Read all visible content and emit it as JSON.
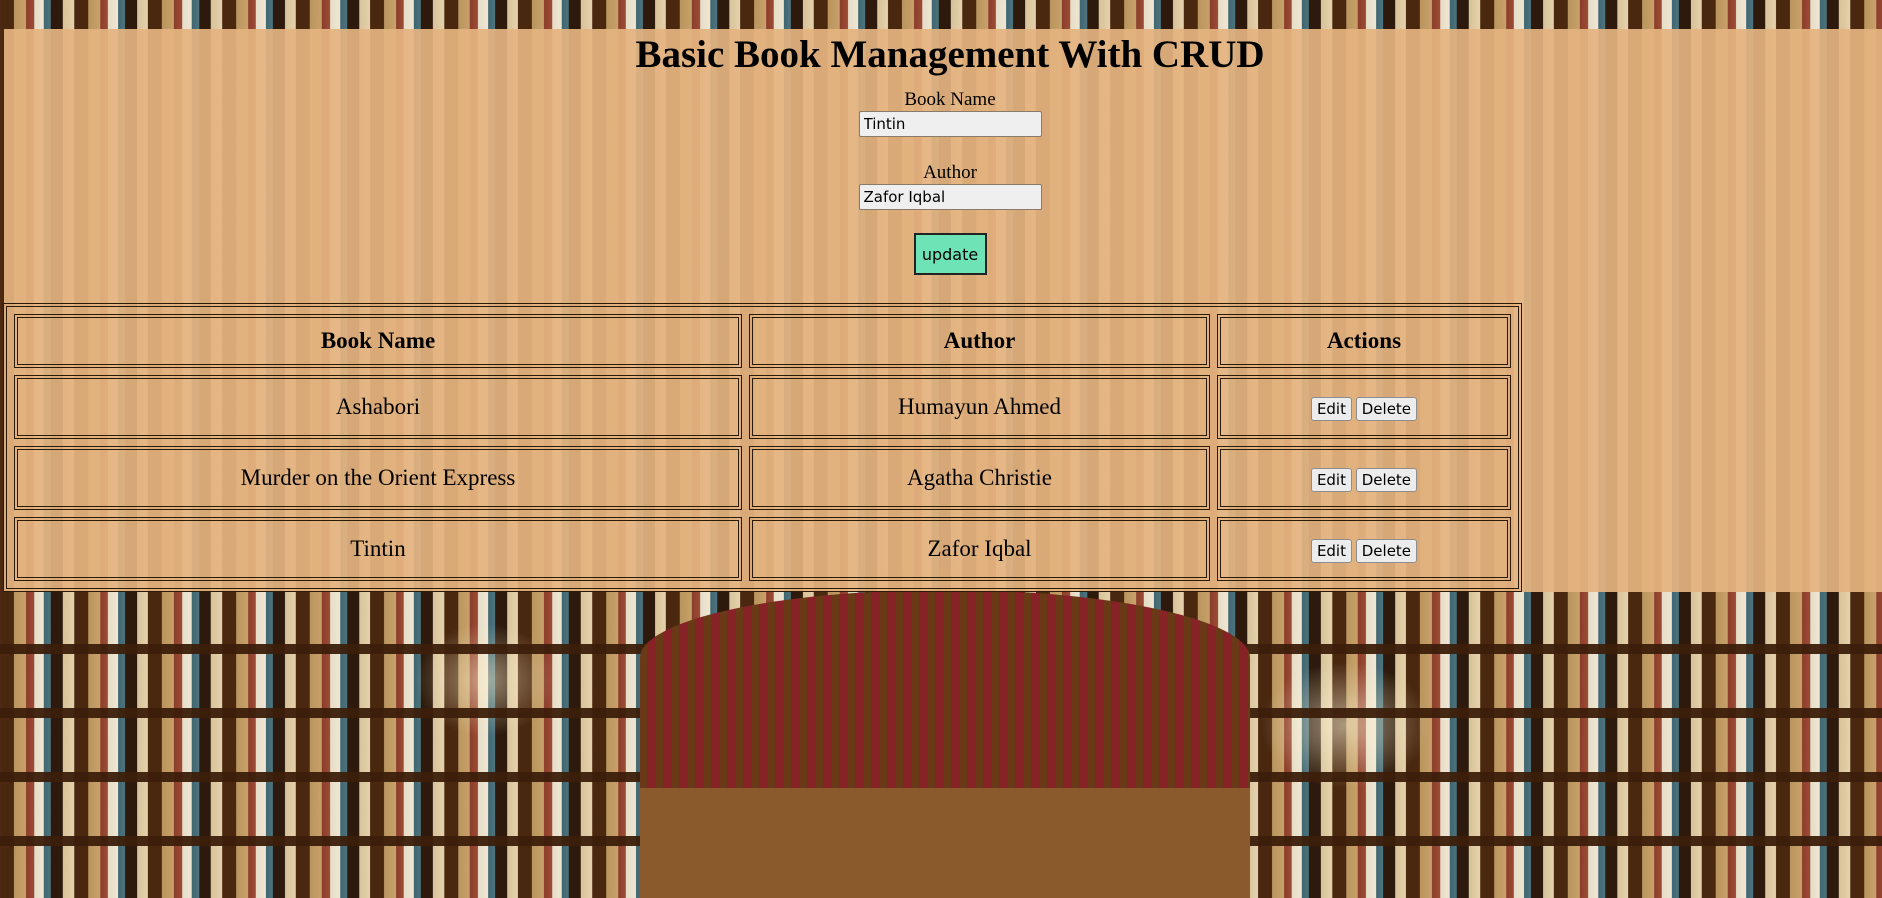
{
  "page": {
    "title": "Basic Book Management With CRUD"
  },
  "form": {
    "book_name_label": "Book Name",
    "book_name_value": "Tintin",
    "author_label": "Author",
    "author_value": "Zafor Iqbal",
    "submit_label": "update"
  },
  "table": {
    "headers": [
      "Book Name",
      "Author",
      "Actions"
    ],
    "rows": [
      {
        "book": "Ashabori",
        "author": "Humayun Ahmed",
        "edit": "Edit",
        "delete": "Delete"
      },
      {
        "book": "Murder on the Orient Express",
        "author": "Agatha Christie",
        "edit": "Edit",
        "delete": "Delete"
      },
      {
        "book": "Tintin",
        "author": "Zafor Iqbal",
        "edit": "Edit",
        "delete": "Delete"
      }
    ]
  },
  "colors": {
    "panel_bg": "#e4b480",
    "update_button": "#6ee3b5"
  }
}
